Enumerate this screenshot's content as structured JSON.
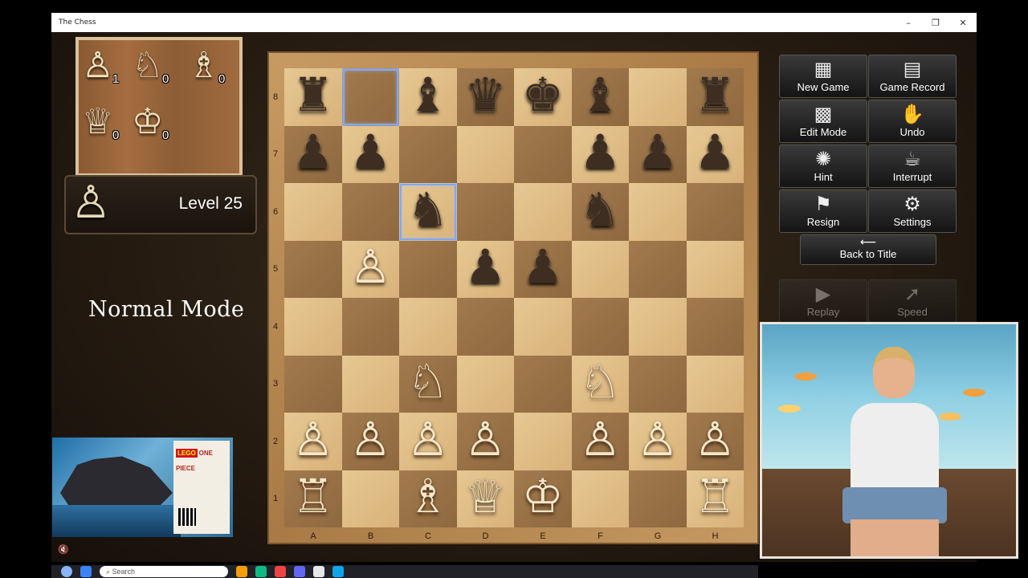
{
  "window": {
    "title": "The Chess"
  },
  "captured": [
    {
      "piece": "♙",
      "count": "1"
    },
    {
      "piece": "♘",
      "count": "0"
    },
    {
      "piece": "♗",
      "count": "0"
    },
    {
      "piece": "♕",
      "count": "0"
    },
    {
      "piece": "♔",
      "count": "0"
    }
  ],
  "level_label": "Level 25",
  "mode_label": "Normal Mode",
  "ranks": [
    "8",
    "7",
    "6",
    "5",
    "4",
    "3",
    "2",
    "1"
  ],
  "files": [
    "A",
    "B",
    "C",
    "D",
    "E",
    "F",
    "G",
    "H"
  ],
  "board": [
    [
      "b♜",
      "",
      "b♝",
      "b♛",
      "b♚",
      "b♝",
      "",
      "b♜"
    ],
    [
      "b♟",
      "b♟",
      "",
      "",
      "",
      "b♟",
      "b♟",
      "b♟"
    ],
    [
      "",
      "",
      "b♞",
      "",
      "",
      "b♞",
      "",
      ""
    ],
    [
      "",
      "w♙",
      "",
      "b♟",
      "b♟",
      "",
      "",
      ""
    ],
    [
      "",
      "",
      "",
      "",
      "",
      "",
      "",
      ""
    ],
    [
      "",
      "",
      "w♘",
      "",
      "",
      "w♘",
      "",
      ""
    ],
    [
      "w♙",
      "w♙",
      "w♙",
      "w♙",
      "",
      "w♙",
      "w♙",
      "w♙"
    ],
    [
      "w♖",
      "",
      "w♗",
      "w♕",
      "w♔",
      "",
      "",
      "w♖"
    ]
  ],
  "highlight_squares": [
    "B8",
    "C6"
  ],
  "buttons": [
    {
      "label": "New Game",
      "icon": "new-game-icon",
      "glyph": "▦",
      "enabled": true
    },
    {
      "label": "Game Record",
      "icon": "game-record-icon",
      "glyph": "▤",
      "enabled": true
    },
    {
      "label": "Edit Mode",
      "icon": "edit-mode-icon",
      "glyph": "▩",
      "enabled": true
    },
    {
      "label": "Undo",
      "icon": "undo-hand-icon",
      "glyph": "✋",
      "enabled": true
    },
    {
      "label": "Hint",
      "icon": "hint-bulb-icon",
      "glyph": "✺",
      "enabled": true
    },
    {
      "label": "Interrupt",
      "icon": "interrupt-icon",
      "glyph": "☕",
      "enabled": true
    },
    {
      "label": "Resign",
      "icon": "resign-flag-icon",
      "glyph": "⚑",
      "enabled": true
    },
    {
      "label": "Settings",
      "icon": "settings-wrench-icon",
      "glyph": "⚙",
      "enabled": true
    },
    {
      "label": "Replay",
      "icon": "replay-icon",
      "glyph": "▶",
      "enabled": false
    },
    {
      "label": "Speed",
      "icon": "speed-icon",
      "glyph": "➚",
      "enabled": false
    }
  ],
  "back_button": {
    "label": "Back to Title",
    "glyph": "⟵"
  },
  "ad": {
    "brand": "LEGO",
    "title": "ONE PIECE"
  },
  "taskbar": {
    "search_placeholder": "Search"
  },
  "mute_glyph": "🔇"
}
